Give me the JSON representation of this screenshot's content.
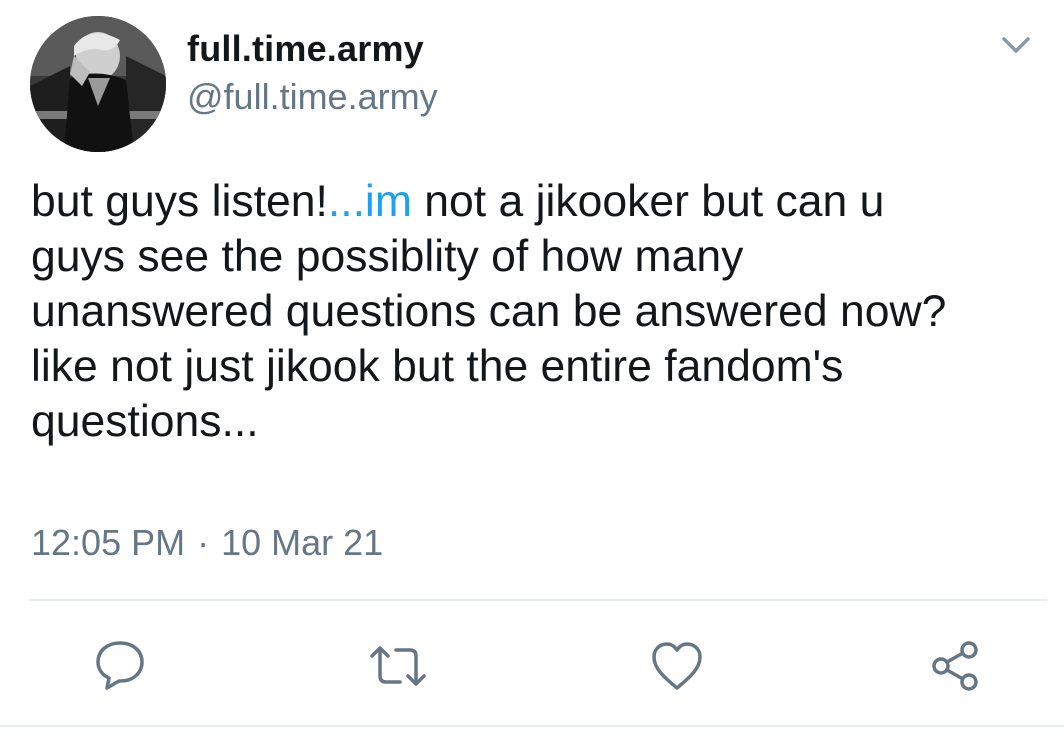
{
  "tweet": {
    "author": {
      "display_name": "full.time.army",
      "handle": "@full.time.army",
      "avatar": "profile-photo"
    },
    "menu_icon": "chevron-down-icon",
    "text": {
      "line1_part1": "but guys listen!",
      "line1_link": "...im",
      "line1_part2": " not a jikooker but can u",
      "line2": "guys see the possiblity of how many",
      "line3": "unanswered questions can be answered now?",
      "line4": "like not just jikook but the entire fandom's",
      "line5": "questions..."
    },
    "time": "12:05 PM",
    "separator": "·",
    "date": "10 Mar 21",
    "actions": [
      "reply-icon",
      "retweet-icon",
      "like-icon",
      "share-icon"
    ],
    "colors": {
      "text": "#14171a",
      "secondary": "#657786",
      "link": "#1da1f2",
      "divider": "#e6ecf0"
    }
  }
}
